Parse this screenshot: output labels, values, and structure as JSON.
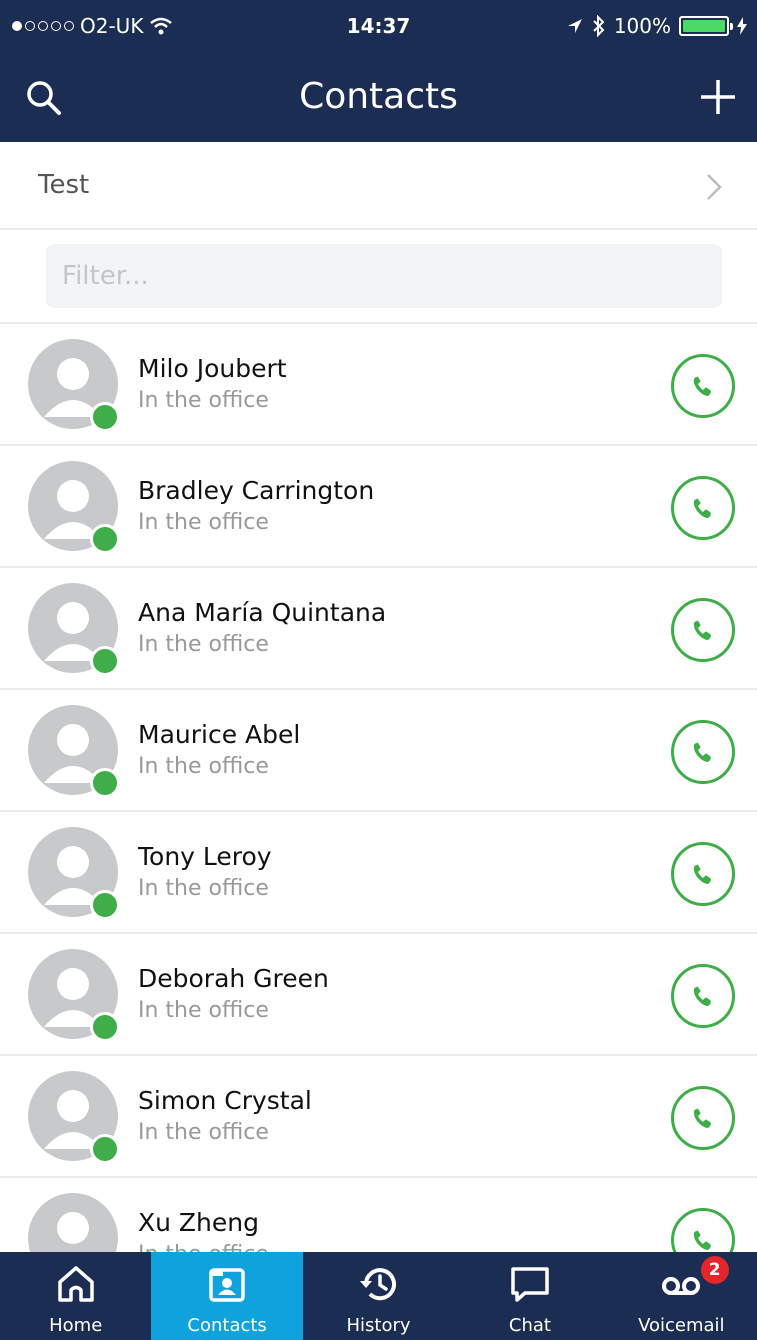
{
  "status_bar": {
    "carrier": "O2-UK",
    "time": "14:37",
    "battery": "100%",
    "signal_bars_filled": 1,
    "signal_bars_total": 5
  },
  "header": {
    "title": "Contacts",
    "search_icon": "search-icon",
    "add_icon": "plus-icon"
  },
  "group": {
    "label": "Test"
  },
  "filter": {
    "placeholder": "Filter..."
  },
  "contacts": [
    {
      "name": "Milo Joubert",
      "status": "In the office"
    },
    {
      "name": "Bradley Carrington",
      "status": "In the office"
    },
    {
      "name": "Ana María Quintana",
      "status": "In the office"
    },
    {
      "name": "Maurice Abel",
      "status": "In the office"
    },
    {
      "name": "Tony Leroy",
      "status": "In the office"
    },
    {
      "name": "Deborah Green",
      "status": "In the office"
    },
    {
      "name": "Simon Crystal",
      "status": "In the office"
    },
    {
      "name": "Xu Zheng",
      "status": "In the office"
    }
  ],
  "tabs": [
    {
      "label": "Home",
      "icon": "home-icon"
    },
    {
      "label": "Contacts",
      "icon": "contacts-icon"
    },
    {
      "label": "History",
      "icon": "history-icon"
    },
    {
      "label": "Chat",
      "icon": "chat-icon"
    },
    {
      "label": "Voicemail",
      "icon": "voicemail-icon"
    }
  ],
  "voicemail_badge": "2",
  "colors": {
    "navy": "#1b2d52",
    "active_tab": "#0fa2dd",
    "presence_green": "#3fae49",
    "badge_red": "#e3262b"
  }
}
